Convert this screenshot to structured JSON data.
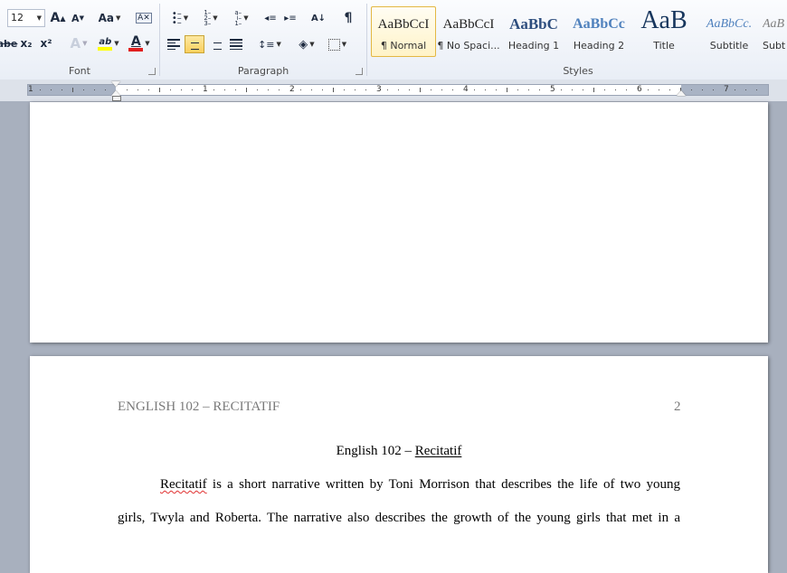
{
  "font_group": {
    "label": "Font",
    "font_size": "12",
    "grow_font": "A",
    "shrink_font": "A",
    "change_case": "Aa",
    "strikethrough": "abe",
    "subscript": "x₂",
    "superscript": "x²",
    "text_effects": "A",
    "highlight": "ab",
    "font_color": "A",
    "highlight_color": "#ffff00",
    "font_color_value": "#e02020"
  },
  "paragraph_group": {
    "label": "Paragraph",
    "sort": "A↓",
    "show_marks": "¶"
  },
  "styles_group": {
    "label": "Styles",
    "items": [
      {
        "preview": "AaBbCcI",
        "name": "¶ Normal"
      },
      {
        "preview": "AaBbCcI",
        "name": "¶ No Spaci..."
      },
      {
        "preview": "AaBbC",
        "name": "Heading 1"
      },
      {
        "preview": "AaBbCc",
        "name": "Heading 2"
      },
      {
        "preview": "AaB",
        "name": "Title"
      },
      {
        "preview": "AaBbCc.",
        "name": "Subtitle"
      },
      {
        "preview": "AaB",
        "name": "Subt"
      }
    ]
  },
  "ruler": {
    "numbers": [
      "1",
      "1",
      "2",
      "3",
      "4",
      "5",
      "6",
      "7"
    ]
  },
  "document": {
    "header_left": "ENGLISH 102 – RECITATIF",
    "page_number": "2",
    "title_prefix": "English 102 – ",
    "title_underlined": "Recitatif",
    "line1_misspelled": "Recitatif",
    "line1_rest": " is a short narrative written by Toni Morrison that describes the life of two young",
    "line2": "girls, Twyla and Roberta. The narrative also describes the growth of the young girls that met in a"
  }
}
